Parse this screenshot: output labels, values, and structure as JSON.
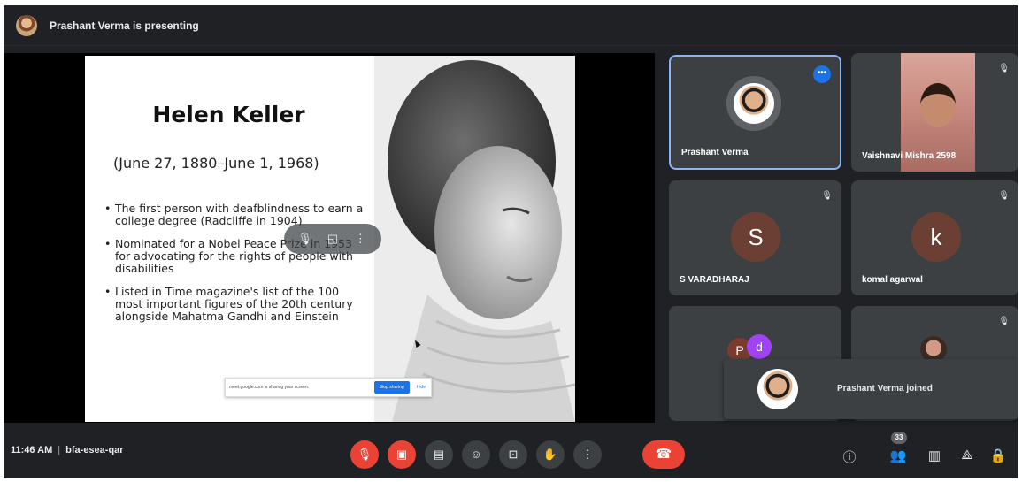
{
  "top_bar": {
    "presenting_text": "Prashant Verma is presenting"
  },
  "slide": {
    "title": "Helen Keller",
    "dates": "(June 27, 1880–June 1, 1968)",
    "bullets": [
      "The first person with deafblindness to earn a college degree (Radcliffe in 1904)",
      "Nominated for a Nobel Peace Prize in 1953 for advocating for the rights of people with disabilities",
      "Listed in Time magazine's list of the 100 most important figures of the 20th century alongside Mahatma Gandhi and Einstein"
    ],
    "stop_banner": {
      "message": "meet.google.com is sharing your screen.",
      "stop_label": "Stop sharing",
      "hide_label": "Hide"
    }
  },
  "participants": [
    {
      "name": "Prashant Verma",
      "selected": true
    },
    {
      "name": "Vaishnavi Mishra 2598"
    },
    {
      "name": "S VARADHARAJ",
      "initial": "S"
    },
    {
      "name": "komal agarwal",
      "initial": "k"
    },
    {
      "initials": [
        "P",
        "d"
      ]
    },
    {}
  ],
  "toast": {
    "text": "Prashant Verma joined"
  },
  "bottom_bar": {
    "time": "11:46 AM",
    "separator": "|",
    "meeting_code": "bfa-esea-qar",
    "participant_count": "33"
  },
  "icons": {
    "mic_off": "microphone-off-icon",
    "cam_off": "camera-off-icon",
    "captions": "captions-icon",
    "emoji": "emoji-icon",
    "present": "present-screen-icon",
    "raise_hand": "raise-hand-icon",
    "more": "more-vertical-icon",
    "leave": "end-call-icon",
    "info": "info-icon",
    "people": "people-icon",
    "chat": "chat-icon",
    "activities": "activities-icon",
    "lock": "host-controls-icon"
  },
  "colors": {
    "background": "#202124",
    "tile": "#3c4043",
    "danger": "#ea4335",
    "accent": "#1a73e8",
    "selected_border": "#8ab4f8"
  }
}
